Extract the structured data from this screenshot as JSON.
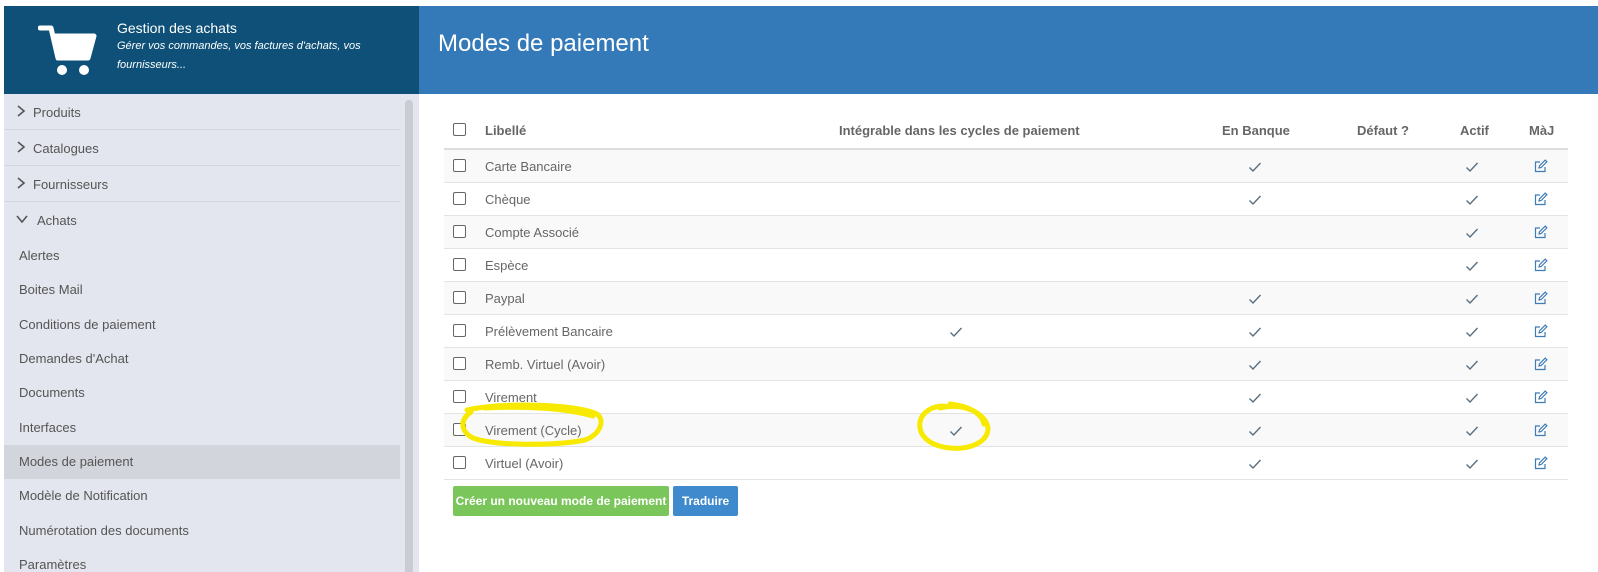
{
  "app": {
    "title": "Gestion des achats",
    "subtitle": "Gérer vos commandes, vos factures d'achats, vos fournisseurs..."
  },
  "header": {
    "page_title": "Modes de paiement"
  },
  "sidebar": {
    "groups": [
      {
        "label": "Produits",
        "expanded": false
      },
      {
        "label": "Catalogues",
        "expanded": false
      },
      {
        "label": "Fournisseurs",
        "expanded": false
      },
      {
        "label": "Achats",
        "expanded": true
      }
    ],
    "items": [
      {
        "label": "Alertes"
      },
      {
        "label": "Boites Mail"
      },
      {
        "label": "Conditions de paiement"
      },
      {
        "label": "Demandes d'Achat"
      },
      {
        "label": "Documents"
      },
      {
        "label": "Interfaces"
      },
      {
        "label": "Modes de paiement",
        "active": true
      },
      {
        "label": "Modèle de Notification"
      },
      {
        "label": "Numérotation des documents"
      },
      {
        "label": "Paramètres"
      }
    ]
  },
  "table": {
    "columns": {
      "libelle": "Libellé",
      "cycles": "Intégrable dans les cycles de paiement",
      "banque": "En Banque",
      "defaut": "Défaut ?",
      "actif": "Actif",
      "maj": "MàJ"
    },
    "rows": [
      {
        "label": "Carte Bancaire",
        "cycles": false,
        "banque": true,
        "defaut": false,
        "actif": true
      },
      {
        "label": "Chèque",
        "cycles": false,
        "banque": true,
        "defaut": false,
        "actif": true
      },
      {
        "label": "Compte Associé",
        "cycles": false,
        "banque": false,
        "defaut": false,
        "actif": true
      },
      {
        "label": "Espèce",
        "cycles": false,
        "banque": false,
        "defaut": false,
        "actif": true
      },
      {
        "label": "Paypal",
        "cycles": false,
        "banque": true,
        "defaut": false,
        "actif": true
      },
      {
        "label": "Prélèvement Bancaire",
        "cycles": true,
        "banque": true,
        "defaut": false,
        "actif": true
      },
      {
        "label": "Remb. Virtuel (Avoir)",
        "cycles": false,
        "banque": true,
        "defaut": false,
        "actif": true
      },
      {
        "label": "Virement",
        "cycles": false,
        "banque": true,
        "defaut": false,
        "actif": true
      },
      {
        "label": "Virement (Cycle)",
        "cycles": true,
        "banque": true,
        "defaut": false,
        "actif": true
      },
      {
        "label": "Virtuel (Avoir)",
        "cycles": false,
        "banque": true,
        "defaut": false,
        "actif": true
      }
    ]
  },
  "buttons": {
    "create": "Créer un nouveau mode de paiement",
    "translate": "Traduire"
  },
  "colors": {
    "brand": "#0e5077",
    "header": "#347ab8",
    "sidebar": "#e3e6ee",
    "success": "#7ac65a",
    "primary": "#3e8acc",
    "highlight": "#f7ea00"
  },
  "icons": {
    "brand": "shopping-cart-icon",
    "group_collapsed": "chevron-right-icon",
    "group_expanded": "chevron-down-icon",
    "check": "check-icon",
    "edit": "edit-icon"
  }
}
